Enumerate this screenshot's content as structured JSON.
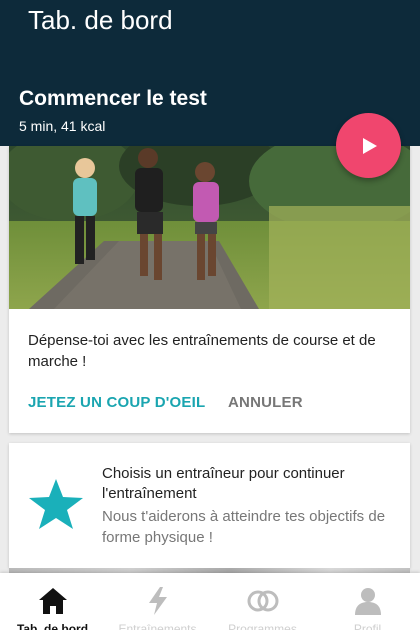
{
  "colors": {
    "header_bg": "#0d2a3a",
    "accent_pink": "#f0466e",
    "accent_teal": "#1aa5b0",
    "secondary_text": "#777777"
  },
  "header": {
    "app_title": "Tab. de bord",
    "test_title": "Commencer le test",
    "test_subtitle": "5 min, 41 kcal",
    "play_icon": "play-icon"
  },
  "card_run": {
    "image": "runners-photo",
    "text": "Dépense-toi avec les entraînements de course et de marche !",
    "action_primary": "JETEZ UN COUP D'OEIL",
    "action_secondary": "ANNULER"
  },
  "card_coach": {
    "icon": "star-icon",
    "title": "Choisis un entraîneur pour continuer l'entraînement",
    "description": "Nous t'aiderons à atteindre tes objectifs de forme physique !"
  },
  "bottom_nav": {
    "items": [
      {
        "label": "Tab. de bord",
        "icon": "home-icon",
        "active": true
      },
      {
        "label": "Entraînements",
        "icon": "lightning-icon",
        "active": false
      },
      {
        "label": "Programmes",
        "icon": "rings-icon",
        "active": false
      },
      {
        "label": "Profil",
        "icon": "person-icon",
        "active": false
      }
    ]
  }
}
